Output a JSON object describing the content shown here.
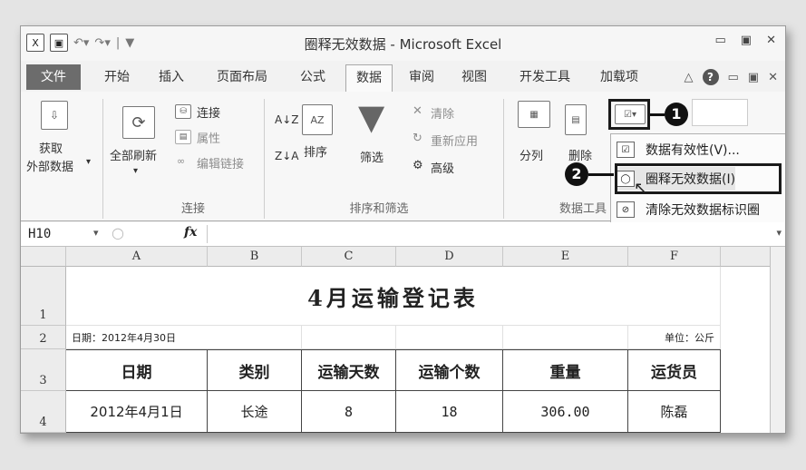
{
  "titlebar": {
    "title": "圈释无效数据 - Microsoft Excel",
    "qat_icons": [
      "excel-icon",
      "save-icon",
      "undo-icon",
      "redo-icon"
    ],
    "qat_sep": "|",
    "qat_more": "▼",
    "window_controls": [
      "▭",
      "▣",
      "✕"
    ]
  },
  "tabs": {
    "items": [
      "文件",
      "开始",
      "插入",
      "页面布局",
      "公式",
      "数据",
      "审阅",
      "视图",
      "开发工具",
      "加载项"
    ],
    "active": "数据",
    "right": [
      "△",
      "?",
      "▭",
      "▣",
      "✕"
    ]
  },
  "ribbon": {
    "get_external": {
      "line1": "获取",
      "line2": "外部数据",
      "arrow": "▾"
    },
    "refresh_all": {
      "label": "全部刷新",
      "arrow": "▾"
    },
    "connections": {
      "items": [
        "连接",
        "属性",
        "编辑链接"
      ],
      "group": "连接"
    },
    "sort": {
      "az": "A↓Z",
      "za": "Z↓A",
      "sort": "排序",
      "filter": "筛选",
      "clear": "清除",
      "reapply": "重新应用",
      "advanced": "高级",
      "group": "排序和筛选"
    },
    "data_tools": {
      "split": "分列",
      "remove": "删除",
      "group": "数据工具"
    }
  },
  "dropdown": {
    "items": [
      "数据有效性(V)...",
      "圈释无效数据(I)",
      "清除无效数据标识圈"
    ]
  },
  "callouts": {
    "one": "1",
    "two": "2"
  },
  "formula_bar": {
    "name_box": "H10",
    "fx": "fx",
    "formula": ""
  },
  "sheet": {
    "columns": [
      "A",
      "B",
      "C",
      "D",
      "E",
      "F"
    ],
    "rows": [
      "1",
      "2",
      "3",
      "4"
    ],
    "title": "4月运输登记表",
    "date_note": "日期：2012年4月30日",
    "unit_note": "单位：公斤",
    "headers": [
      "日期",
      "类别",
      "运输天数",
      "运输个数",
      "重量",
      "运货员"
    ],
    "row4": [
      "2012年4月1日",
      "长途",
      "8",
      "18",
      "306.00",
      "陈磊"
    ]
  },
  "colors": {
    "file_tab": "#6c6c6c",
    "highlight_border": "#1a1a1a",
    "badge": "#111111"
  }
}
